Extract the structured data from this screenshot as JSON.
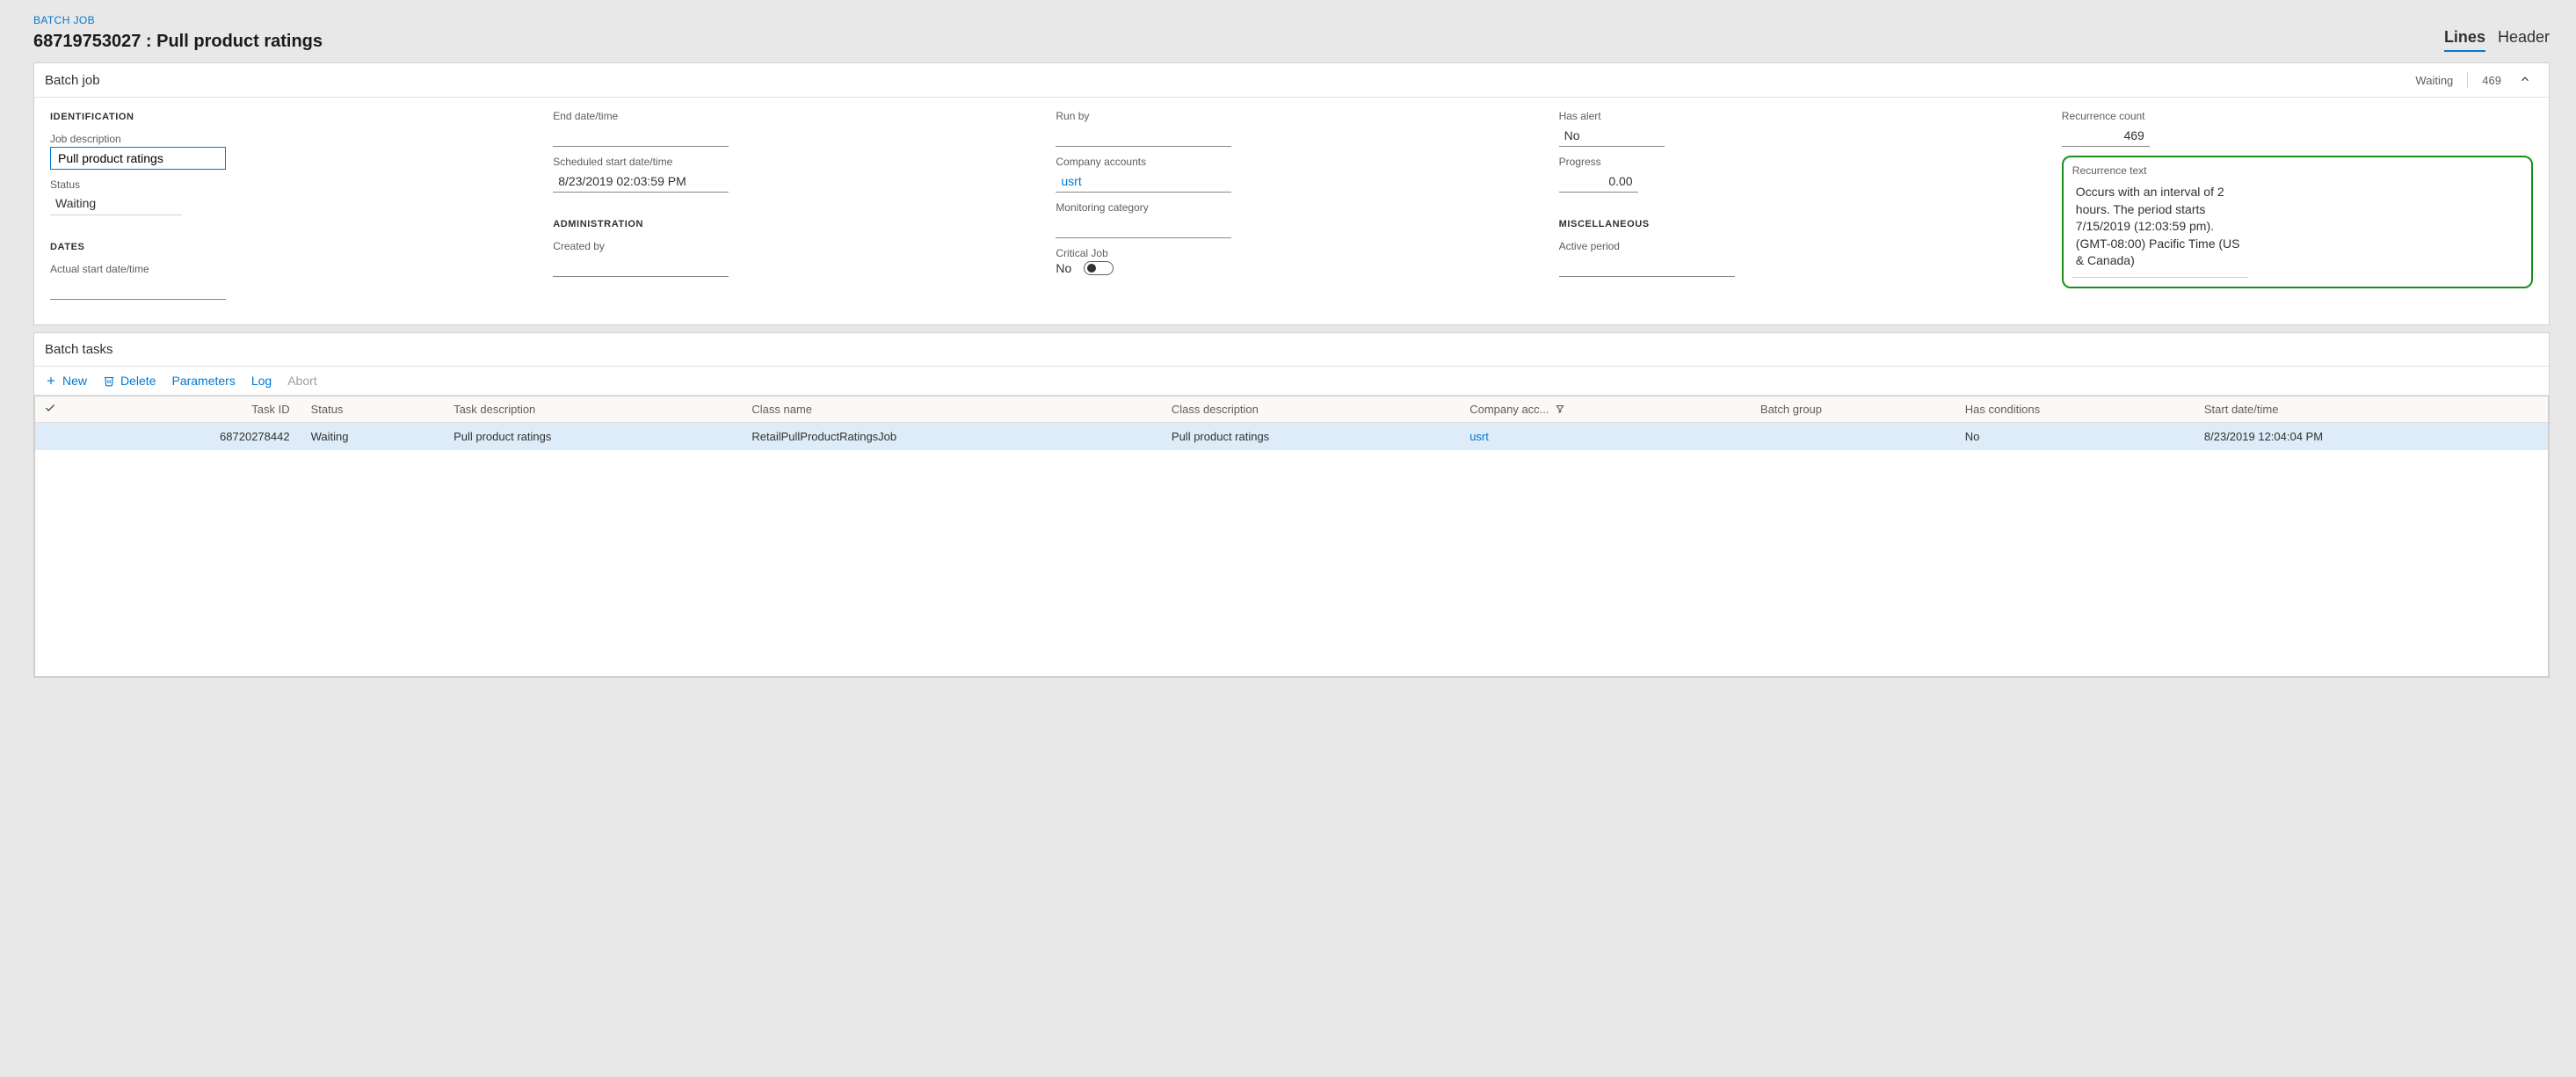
{
  "breadcrumb": "BATCH JOB",
  "page_title": "68719753027 : Pull product ratings",
  "view_tabs": {
    "lines": "Lines",
    "header": "Header"
  },
  "batch_job_card": {
    "title": "Batch job",
    "status_chip": "Waiting",
    "count_chip": "469",
    "identification": {
      "heading": "IDENTIFICATION",
      "job_description_label": "Job description",
      "job_description_value": "Pull product ratings",
      "status_label": "Status",
      "status_value": "Waiting"
    },
    "dates": {
      "heading": "DATES",
      "actual_start_label": "Actual start date/time",
      "actual_start_value": "",
      "end_label": "End date/time",
      "end_value": "",
      "scheduled_label": "Scheduled start date/time",
      "scheduled_value": "8/23/2019 02:03:59 PM"
    },
    "administration": {
      "heading": "ADMINISTRATION",
      "created_by_label": "Created by",
      "created_by_value": ""
    },
    "run": {
      "run_by_label": "Run by",
      "run_by_value": "",
      "company_label": "Company accounts",
      "company_value": "usrt",
      "monitoring_label": "Monitoring category",
      "monitoring_value": "",
      "critical_label": "Critical Job",
      "critical_value": "No"
    },
    "alerts": {
      "has_alert_label": "Has alert",
      "has_alert_value": "No",
      "progress_label": "Progress",
      "progress_value": "0.00"
    },
    "misc": {
      "heading": "MISCELLANEOUS",
      "active_period_label": "Active period",
      "active_period_value": ""
    },
    "recurrence": {
      "count_label": "Recurrence count",
      "count_value": "469",
      "text_label": "Recurrence text",
      "text_value": "Occurs with an interval of 2 hours. The period starts 7/15/2019 (12:03:59 pm). (GMT-08:00) Pacific Time (US & Canada)"
    }
  },
  "tasks_card": {
    "title": "Batch tasks",
    "toolbar": {
      "new": "New",
      "delete": "Delete",
      "parameters": "Parameters",
      "log": "Log",
      "abort": "Abort"
    },
    "columns": {
      "task_id": "Task ID",
      "status": "Status",
      "task_desc": "Task description",
      "class_name": "Class name",
      "class_desc": "Class description",
      "company": "Company acc...",
      "batch_group": "Batch group",
      "has_conditions": "Has conditions",
      "start": "Start date/time"
    },
    "rows": [
      {
        "task_id": "68720278442",
        "status": "Waiting",
        "task_desc": "Pull product ratings",
        "class_name": "RetailPullProductRatingsJob",
        "class_desc": "Pull product ratings",
        "company": "usrt",
        "batch_group": "",
        "has_conditions": "No",
        "start": "8/23/2019 12:04:04 PM"
      }
    ]
  }
}
